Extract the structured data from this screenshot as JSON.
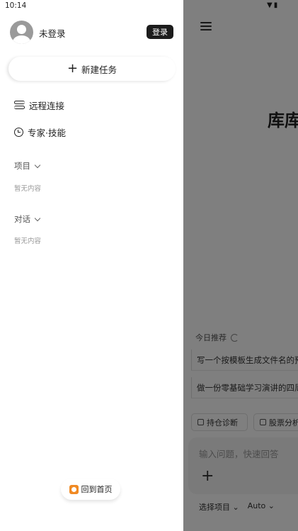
{
  "status_bar": {
    "time": "10:14"
  },
  "drawer": {
    "user": {
      "name": "未登录",
      "login_label": "登录"
    },
    "new_task_label": "新建任务",
    "nav": [
      {
        "label": "远程连接",
        "icon": "remote-connect-icon"
      },
      {
        "label": "专家·技能",
        "icon": "expert-icon"
      }
    ],
    "sections": {
      "projects": {
        "label": "项目",
        "empty_text": "暂无内容"
      },
      "chats": {
        "label": "对话",
        "empty_text": "暂无内容"
      }
    },
    "home_label": "回到首页"
  },
  "main": {
    "title": "库库",
    "recommend": {
      "heading": "今日推荐",
      "items": [
        "写一个按模板生成文件名的预",
        "做一份零基础学习演讲的四周计"
      ]
    },
    "chips": [
      "持仓诊断",
      "股票分析"
    ],
    "input_placeholder": "输入问题，快速回答",
    "bottom": {
      "project_select": "选择项目",
      "model_select": "Auto"
    }
  },
  "colors": {
    "login_button": "#1c1c1c",
    "scrim": "rgba(0,0,0,0.5)",
    "home_icon": "#f08a24"
  }
}
